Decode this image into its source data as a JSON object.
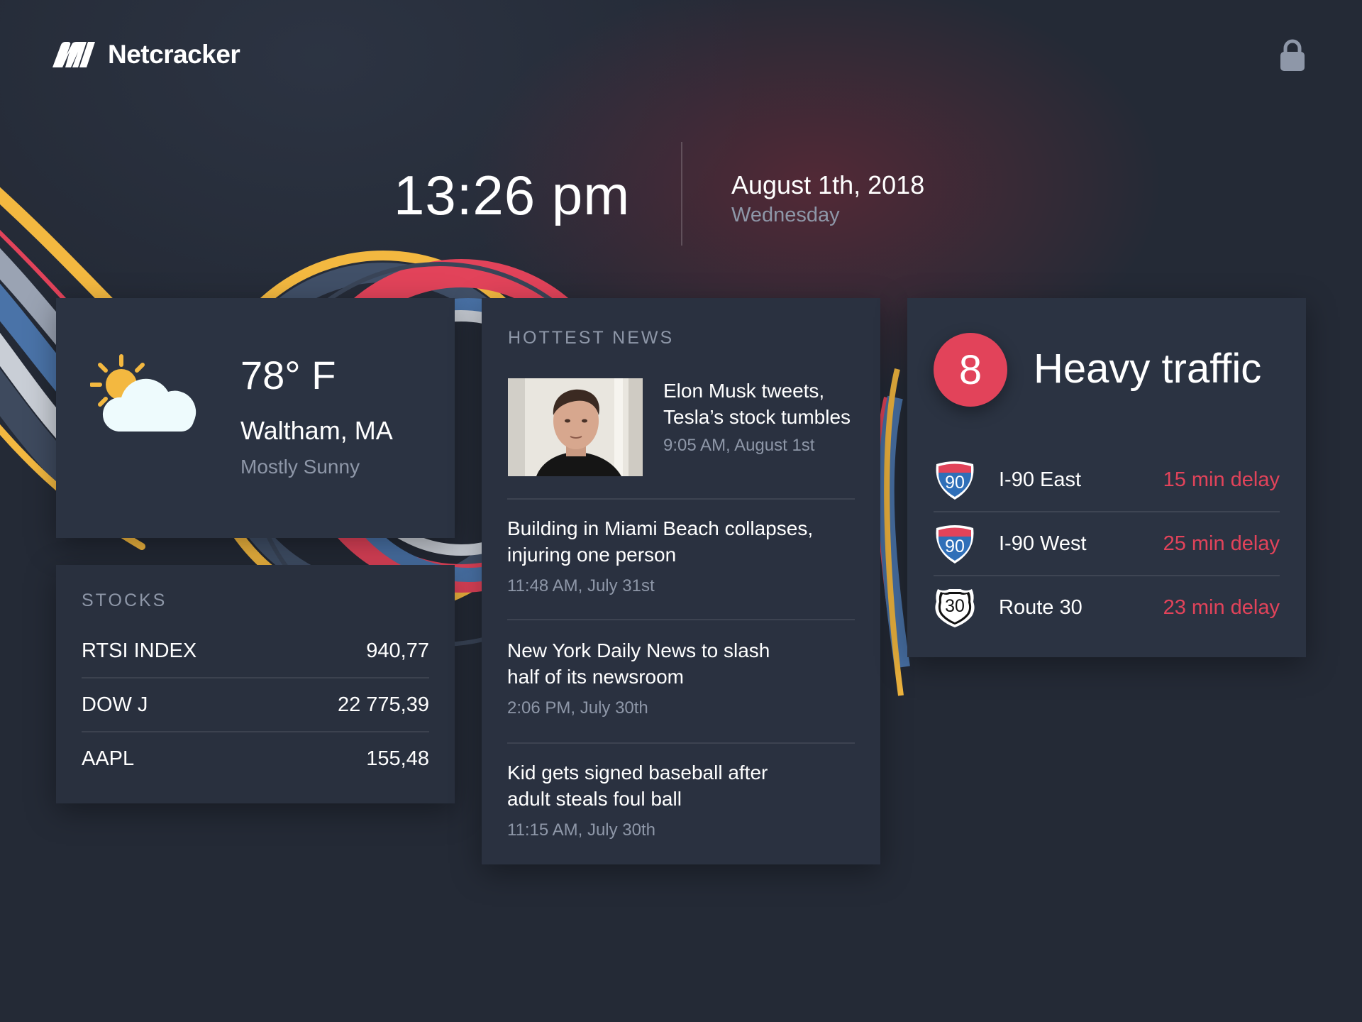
{
  "brand": {
    "name": "Netcracker"
  },
  "header": {
    "lock_icon": "lock-icon"
  },
  "clock": {
    "time": "13:26 pm",
    "date": "August 1th, 2018",
    "weekday": "Wednesday"
  },
  "weather": {
    "icon": "partly-sunny-icon",
    "temperature": "78° F",
    "location": "Waltham, MA",
    "condition": "Mostly Sunny"
  },
  "stocks": {
    "title": "STOCKS",
    "items": [
      {
        "symbol": "RTSI INDEX",
        "value": "940,77"
      },
      {
        "symbol": "DOW J",
        "value": "22 775,39"
      },
      {
        "symbol": "AAPL",
        "value": "155,48"
      }
    ]
  },
  "news": {
    "title": "HOTTEST NEWS",
    "items": [
      {
        "headline": "Elon Musk tweets, Tesla’s stock tumbles",
        "time": "9:05 AM, August 1st"
      },
      {
        "headline": "Building in Miami Beach collapses, injuring one person",
        "time": "11:48 AM, July 31st"
      },
      {
        "headline": "New York Daily News to slash half of its newsroom",
        "time": "2:06 PM, July 30th"
      },
      {
        "headline": "Kid gets signed baseball after adult steals foul ball",
        "time": "11:15 AM, July 30th"
      }
    ]
  },
  "traffic": {
    "level": "8",
    "status": "Heavy traffic",
    "routes": [
      {
        "shield": "90",
        "shield_type": "interstate",
        "name": "I-90 East",
        "delay": "15 min delay"
      },
      {
        "shield": "90",
        "shield_type": "interstate",
        "name": "I-90 West",
        "delay": "25 min delay"
      },
      {
        "shield": "30",
        "shield_type": "us-route",
        "name": "Route 30",
        "delay": "23 min delay"
      }
    ]
  },
  "colors": {
    "background": "#242a36",
    "card": "#2a3140",
    "accent_red": "#e2435a",
    "accent_yellow": "#f3b840",
    "muted_text": "#8e97a8"
  }
}
